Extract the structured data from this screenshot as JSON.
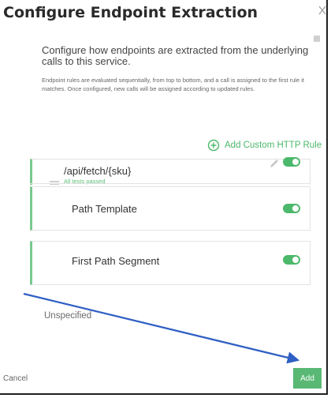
{
  "dialog": {
    "title": "Configure Endpoint Extraction",
    "description": "Configure how endpoints are extracted from the underlying calls to this service.",
    "rules_note": "Endpoint rules are evaluated sequentially, from top to bottom, and a call is assigned to the first rule it matches. Once configured, new calls will be assigned according to updated rules.",
    "add_rule_label": "Add Custom HTTP Rule",
    "fallback_label": "Unspecified",
    "cancel_label": "Cancel",
    "add_label": "Add"
  },
  "rules": [
    {
      "label": "/api/fetch/{sku}",
      "status": "All tests passed",
      "enabled": true,
      "editable": true
    },
    {
      "label": "Path Template",
      "enabled": true
    },
    {
      "label": "First Path Segment",
      "enabled": true
    }
  ],
  "colors": {
    "accent": "#4cb86b",
    "annotation_arrow": "#2f5fc4"
  }
}
